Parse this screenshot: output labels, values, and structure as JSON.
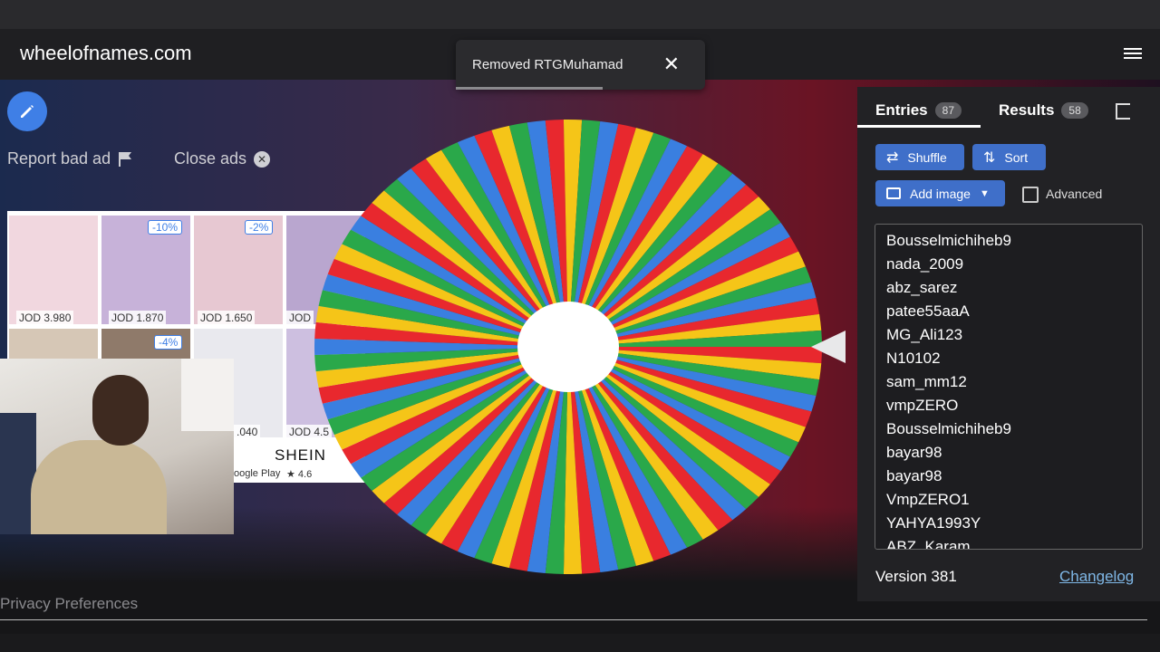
{
  "app": {
    "title": "wheelofnames.com"
  },
  "toast": {
    "message": "Removed RTGMuhamad",
    "close_glyph": "✕"
  },
  "ads": {
    "report_label": "Report bad ad",
    "close_label": "Close ads",
    "products": [
      {
        "price": "JOD 3.980",
        "badge": ""
      },
      {
        "price": "JOD 1.870",
        "badge": "-10%"
      },
      {
        "price": "JOD 1.650",
        "badge": "-2%"
      },
      {
        "price": "JOD",
        "badge": ""
      },
      {
        "price": "",
        "badge": "-4%"
      },
      {
        "price": ".040",
        "badge": ""
      },
      {
        "price": "JOD 4.5",
        "badge": ""
      }
    ],
    "brand": "SHEIN",
    "store": "oogle Play",
    "rating": "★ 4.6"
  },
  "tabs": [
    {
      "label": "Entries",
      "count": "87"
    },
    {
      "label": "Results",
      "count": "58"
    }
  ],
  "toolbar": {
    "shuffle_label": "Shuffle",
    "sort_label": "Sort",
    "add_image_label": "Add image",
    "advanced_label": "Advanced"
  },
  "entries": [
    "Bousselmichiheb9",
    "nada_2009",
    "abz_sarez",
    "patee55aaA",
    "MG_Ali123",
    "N10102",
    "sam_mm12",
    "vmpZERO",
    "Bousselmichiheb9",
    "bayar98",
    "bayar98",
    "VmpZERO1",
    "YAHYA1993Y",
    "ABZ_Karam"
  ],
  "footer": {
    "version": "Version 381",
    "changelog": "Changelog",
    "privacy": "Privacy Preferences"
  },
  "wheel": {
    "segment_colors": [
      "#e8282e",
      "#f5c518",
      "#2aa84a",
      "#3a7fe0"
    ],
    "segments": 87
  }
}
